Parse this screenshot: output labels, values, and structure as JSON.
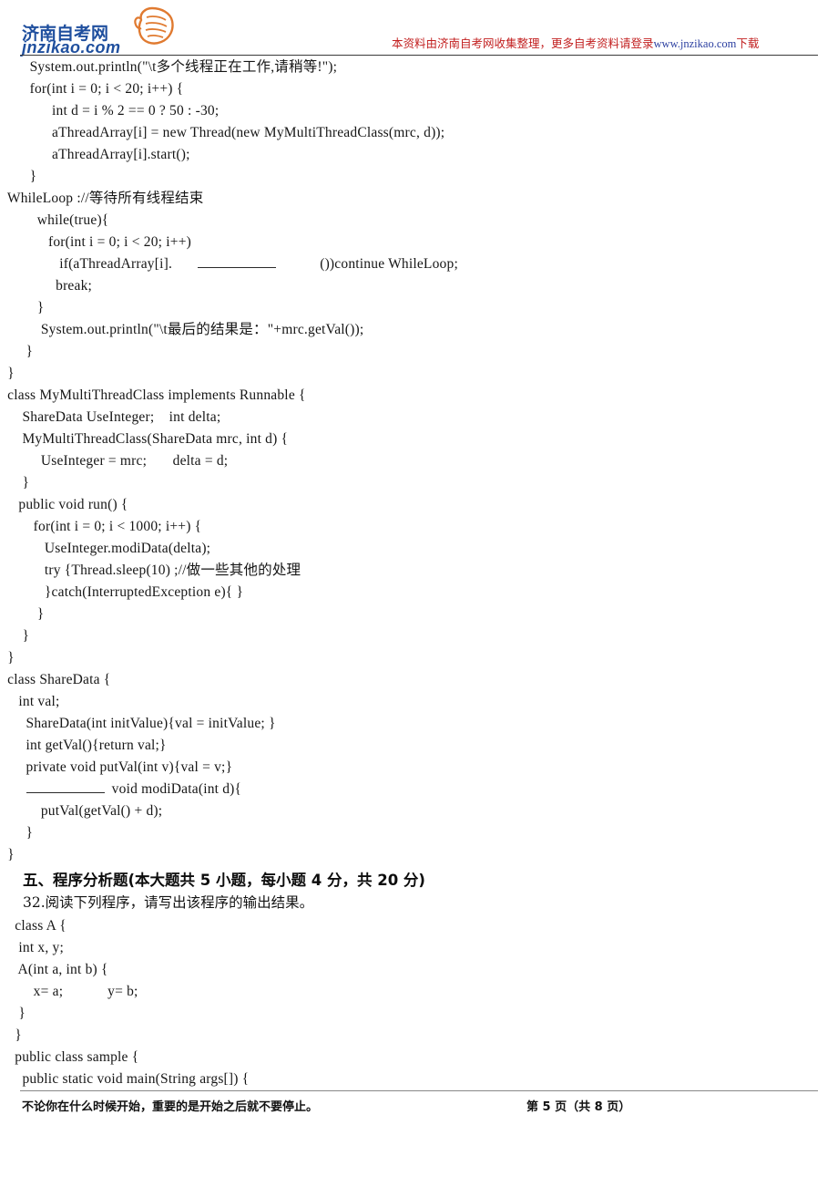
{
  "header": {
    "logo_cn": "济南自考网",
    "logo_en": "jnzikao.com",
    "logo_icon": "fist-hand-icon",
    "notice_prefix": "本资料由济南自考网收集整理，更多自考资料请登录",
    "notice_url": "www.jnzikao.com",
    "notice_suffix": "下载",
    "notice_color": "#c21f1f",
    "url_color": "#2b3fa0",
    "logo_color": "#1f4f9e"
  },
  "code_block_1": {
    "lines": [
      "        System.out.println(\"\\t多个线程正在工作,请稍等!\");",
      "        for(int i = 0; i < 20; i++) {",
      "              int d = i % 2 == 0 ? 50 : -30;",
      "              aThreadArray[i] = new Thread(new MyMultiThreadClass(mrc, d));",
      "              aThreadArray[i].start();",
      "        }",
      "  WhileLoop ://等待所有线程结束",
      "          while(true){",
      "             for(int i = 0; i < 20; i++)",
      "                if(aThreadArray[i].",
      "               break;",
      "          }",
      "           System.out.println(\"\\t最后的结果是：\"+mrc.getVal());",
      "       }",
      "  }",
      "  class MyMultiThreadClass implements Runnable {",
      "      ShareData UseInteger;    int delta;",
      "      MyMultiThreadClass(ShareData mrc, int d) {",
      "           UseInteger = mrc;       delta = d;",
      "      }",
      "     public void run() {",
      "         for(int i = 0; i < 1000; i++) {",
      "            UseInteger.modiData(delta);",
      "            try {Thread.sleep(10) ;//做一些其他的处理",
      "            }catch(InterruptedException e){ }",
      "          }",
      "      }",
      "  }",
      "  class ShareData {",
      "     int val;",
      "       ShareData(int initValue){val = initValue; }",
      "       int getVal(){return val;}",
      "       private void putVal(int v){val = v;}",
      "              void modiData(int d){",
      "           putVal(getVal() + d);",
      "       }",
      "  }"
    ],
    "blank_line_if": {
      "prefix": "                if(aThreadArray[i].",
      "suffix": "  ())continue WhileLoop;"
    },
    "blank_line_modidata": {
      "prefix": "       ",
      "suffix": "  void modiData(int d){"
    }
  },
  "section": {
    "heading": "五、程序分析题(本大题共 5 小题，每小题 4 分，共 20 分)",
    "question_number": "32.",
    "question_text": "阅读下列程序，请写出该程序的输出结果。"
  },
  "code_block_2": {
    "lines": [
      "    class A {",
      "     int x, y;",
      "     A(int a, int b) {",
      "         x= a;            y= b;",
      "     }",
      "    }",
      "    public class sample {",
      "      public static void main(String args[]) {"
    ]
  },
  "footer": {
    "motto": "不论你在什么时候开始，重要的是开始之后就不要停止。",
    "page_label": "第 5 页（共 8 页）"
  }
}
